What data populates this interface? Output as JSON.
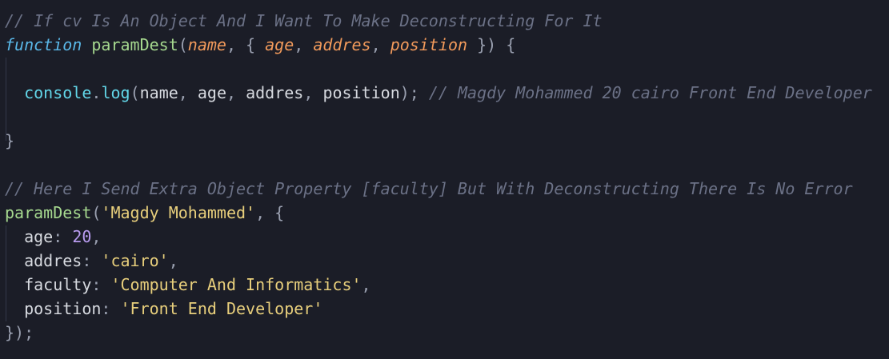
{
  "editor": {
    "lines": [
      {
        "tokens": [
          {
            "type": "comment",
            "text": "// If cv Is An Object And I Want To Make Deconstructing For It"
          }
        ]
      },
      {
        "tokens": [
          {
            "type": "keyword",
            "text": "function"
          },
          {
            "type": "text",
            "text": " "
          },
          {
            "type": "function",
            "text": "paramDest"
          },
          {
            "type": "punct",
            "text": "("
          },
          {
            "type": "param",
            "text": "name"
          },
          {
            "type": "punct",
            "text": ", { "
          },
          {
            "type": "param",
            "text": "age"
          },
          {
            "type": "punct",
            "text": ", "
          },
          {
            "type": "param",
            "text": "addres"
          },
          {
            "type": "punct",
            "text": ", "
          },
          {
            "type": "param",
            "text": "position"
          },
          {
            "type": "punct",
            "text": " }) {"
          }
        ]
      },
      {
        "tokens": []
      },
      {
        "tokens": [
          {
            "type": "text",
            "text": "  "
          },
          {
            "type": "object",
            "text": "console"
          },
          {
            "type": "punct",
            "text": "."
          },
          {
            "type": "object",
            "text": "log"
          },
          {
            "type": "punct",
            "text": "("
          },
          {
            "type": "text",
            "text": "name"
          },
          {
            "type": "punct",
            "text": ", "
          },
          {
            "type": "text",
            "text": "age"
          },
          {
            "type": "punct",
            "text": ", "
          },
          {
            "type": "text",
            "text": "addres"
          },
          {
            "type": "punct",
            "text": ", "
          },
          {
            "type": "text",
            "text": "position"
          },
          {
            "type": "punct",
            "text": "); "
          },
          {
            "type": "comment",
            "text": "// Magdy Mohammed 20 cairo Front End Developer"
          }
        ]
      },
      {
        "tokens": []
      },
      {
        "tokens": [
          {
            "type": "punct",
            "text": "}"
          }
        ]
      },
      {
        "tokens": []
      },
      {
        "tokens": [
          {
            "type": "comment",
            "text": "// Here I Send Extra Object Property [faculty] But With Deconstructing There Is No Error"
          }
        ]
      },
      {
        "tokens": [
          {
            "type": "function",
            "text": "paramDest"
          },
          {
            "type": "punct",
            "text": "("
          },
          {
            "type": "string",
            "text": "'Magdy Mohammed'"
          },
          {
            "type": "punct",
            "text": ", {"
          }
        ]
      },
      {
        "tokens": [
          {
            "type": "text",
            "text": "  age"
          },
          {
            "type": "punct",
            "text": ": "
          },
          {
            "type": "number",
            "text": "20"
          },
          {
            "type": "punct",
            "text": ","
          }
        ]
      },
      {
        "tokens": [
          {
            "type": "text",
            "text": "  addres"
          },
          {
            "type": "punct",
            "text": ": "
          },
          {
            "type": "string",
            "text": "'cairo'"
          },
          {
            "type": "punct",
            "text": ","
          }
        ]
      },
      {
        "tokens": [
          {
            "type": "text",
            "text": "  faculty"
          },
          {
            "type": "punct",
            "text": ": "
          },
          {
            "type": "string",
            "text": "'Computer And Informatics'"
          },
          {
            "type": "punct",
            "text": ","
          }
        ]
      },
      {
        "tokens": [
          {
            "type": "text",
            "text": "  position"
          },
          {
            "type": "punct",
            "text": ": "
          },
          {
            "type": "string",
            "text": "'Front End Developer'"
          }
        ]
      },
      {
        "tokens": [
          {
            "type": "punct",
            "text": "});"
          }
        ]
      }
    ]
  },
  "colors": {
    "background": "#1b1d27",
    "comment": "#6b7186",
    "keyword": "#5ab8e8",
    "function": "#a6d98f",
    "param": "#f29a5b",
    "string": "#e8cf7c",
    "number": "#b99cf0",
    "object": "#62d6e8",
    "text": "#d7dae0"
  }
}
